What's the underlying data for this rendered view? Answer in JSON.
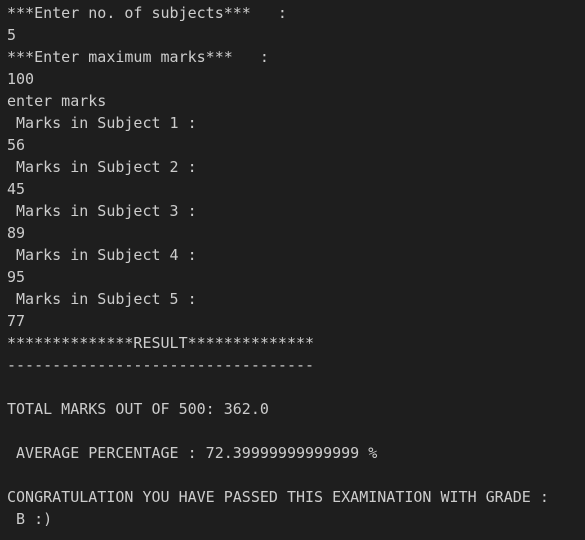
{
  "terminal": {
    "lines": [
      "***Enter no. of subjects***   :",
      "5",
      "***Enter maximum marks***   :",
      "100",
      "enter marks",
      " Marks in Subject 1 :",
      "56",
      " Marks in Subject 2 :",
      "45",
      " Marks in Subject 3 :",
      "89",
      " Marks in Subject 4 :",
      "95",
      " Marks in Subject 5 :",
      "77",
      "**************RESULT**************",
      "----------------------------------",
      "",
      "TOTAL MARKS OUT OF 500: 362.0",
      "",
      " AVERAGE PERCENTAGE : 72.39999999999999 %",
      "",
      "CONGRATULATION YOU HAVE PASSED THIS EXAMINATION WITH GRADE :",
      " B :)"
    ]
  }
}
